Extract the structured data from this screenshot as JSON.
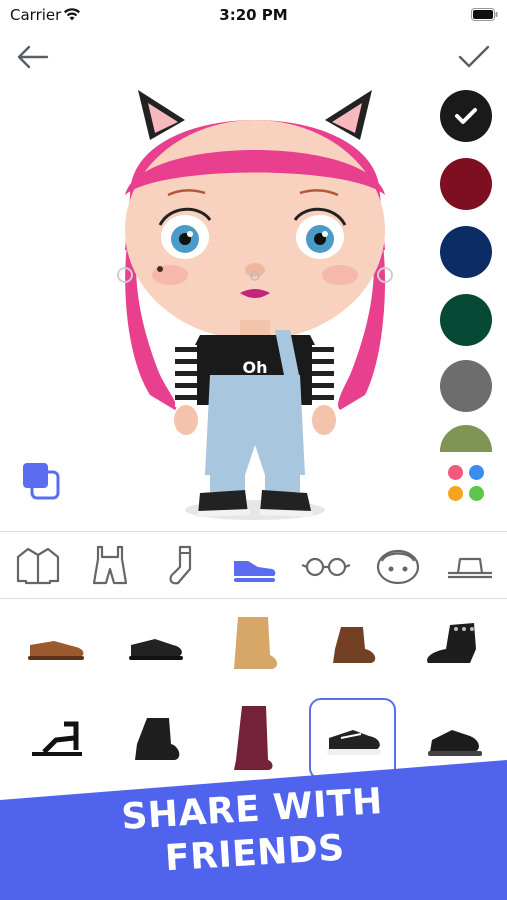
{
  "status": {
    "carrier": "Carrier",
    "time": "3:20 PM"
  },
  "nav": {
    "back_icon": "arrow-left-icon",
    "confirm_icon": "checkmark-icon"
  },
  "colors": {
    "swatches": [
      {
        "name": "black",
        "hex": "#1a1a1a",
        "selected": true
      },
      {
        "name": "burgundy",
        "hex": "#7d0f20",
        "selected": false
      },
      {
        "name": "navy",
        "hex": "#0c2c64",
        "selected": false
      },
      {
        "name": "green",
        "hex": "#064a36",
        "selected": false
      },
      {
        "name": "gray",
        "hex": "#6d6d6d",
        "selected": false
      },
      {
        "name": "olive",
        "hex": "#7f9455",
        "selected": false
      }
    ],
    "palette_dots": [
      "#f15a7e",
      "#3a8cf2",
      "#f6a41d",
      "#5cc64a"
    ],
    "accent": "#5b6cf0"
  },
  "categories": [
    {
      "name": "jacket",
      "icon": "jacket-icon",
      "active": false
    },
    {
      "name": "overalls",
      "icon": "overalls-icon",
      "active": false
    },
    {
      "name": "socks",
      "icon": "sock-icon",
      "active": false
    },
    {
      "name": "shoes",
      "icon": "shoe-icon",
      "active": true
    },
    {
      "name": "glasses",
      "icon": "glasses-icon",
      "active": false
    },
    {
      "name": "face",
      "icon": "face-icon",
      "active": false
    },
    {
      "name": "hat",
      "icon": "hat-icon",
      "active": false
    }
  ],
  "items": {
    "row1": [
      "brown-loafer",
      "black-sneaker",
      "tan-boot",
      "brown-ankle-boot",
      "black-studded-boot"
    ],
    "row2": [
      "black-sandal",
      "black-chelsea-boot",
      "burgundy-tall-boot",
      "black-converse-sneaker",
      "black-hightop-sneaker"
    ],
    "selected": "black-converse-sneaker"
  },
  "banner": {
    "line1": "SHARE WITH",
    "line2": "FRIENDS",
    "color": "#4f63ec"
  }
}
